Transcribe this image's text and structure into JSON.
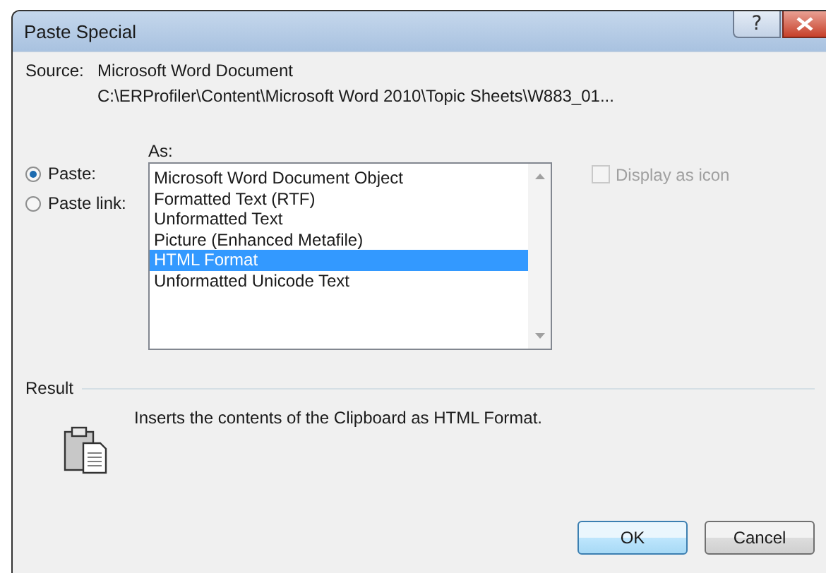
{
  "window": {
    "title": "Paste Special",
    "help_button": "?"
  },
  "source": {
    "label": "Source:",
    "lines": [
      "Microsoft Word Document",
      "C:\\ERProfiler\\Content\\Microsoft Word 2010\\Topic Sheets\\W883_01..."
    ]
  },
  "options": [
    {
      "label": "Paste:",
      "selected": true
    },
    {
      "label": "Paste link:",
      "selected": false
    }
  ],
  "as": {
    "label": "As:",
    "items": [
      {
        "label": "Microsoft Word Document Object",
        "selected": false
      },
      {
        "label": "Formatted Text (RTF)",
        "selected": false
      },
      {
        "label": "Unformatted Text",
        "selected": false
      },
      {
        "label": "Picture (Enhanced Metafile)",
        "selected": false
      },
      {
        "label": "HTML Format",
        "selected": true
      },
      {
        "label": "Unformatted Unicode Text",
        "selected": false
      }
    ]
  },
  "display_as_icon": {
    "label": "Display as icon",
    "checked": false,
    "disabled": true
  },
  "result": {
    "label": "Result",
    "description": "Inserts the contents of the Clipboard as HTML Format."
  },
  "buttons": [
    {
      "label": "OK",
      "default": true
    },
    {
      "label": "Cancel",
      "default": false
    }
  ]
}
